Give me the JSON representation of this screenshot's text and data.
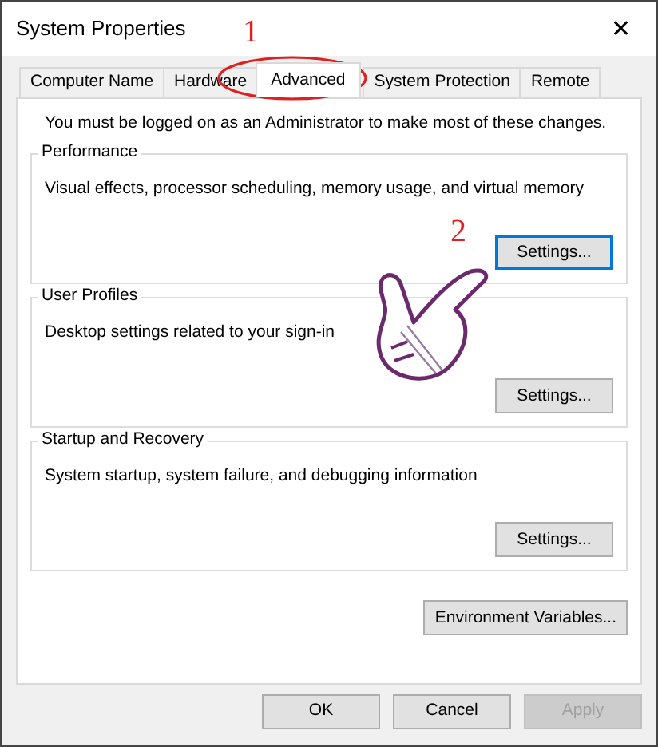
{
  "window": {
    "title": "System Properties",
    "close": "✕"
  },
  "tabs": [
    {
      "label": "Computer Name",
      "selected": false
    },
    {
      "label": "Hardware",
      "selected": false
    },
    {
      "label": "Advanced",
      "selected": true
    },
    {
      "label": "System Protection",
      "selected": false
    },
    {
      "label": "Remote",
      "selected": false
    }
  ],
  "notice": "You must be logged on as an Administrator to make most of these changes.",
  "groups": [
    {
      "title": "Performance",
      "description": "Visual effects, processor scheduling, memory usage, and virtual memory",
      "button": {
        "label": "Settings...",
        "focused": true
      }
    },
    {
      "title": "User Profiles",
      "description": "Desktop settings related to your sign-in",
      "button": {
        "label": "Settings...",
        "focused": false
      }
    },
    {
      "title": "Startup and Recovery",
      "description": "System startup, system failure, and debugging information",
      "button": {
        "label": "Settings...",
        "focused": false
      }
    }
  ],
  "environment_button": {
    "label": "Environment Variables...",
    "focused": false
  },
  "dialog_buttons": [
    {
      "label": "OK",
      "disabled": false
    },
    {
      "label": "Cancel",
      "disabled": false
    },
    {
      "label": "Apply",
      "disabled": true
    }
  ],
  "annotations": [
    {
      "text": "1"
    },
    {
      "text": "2"
    }
  ]
}
